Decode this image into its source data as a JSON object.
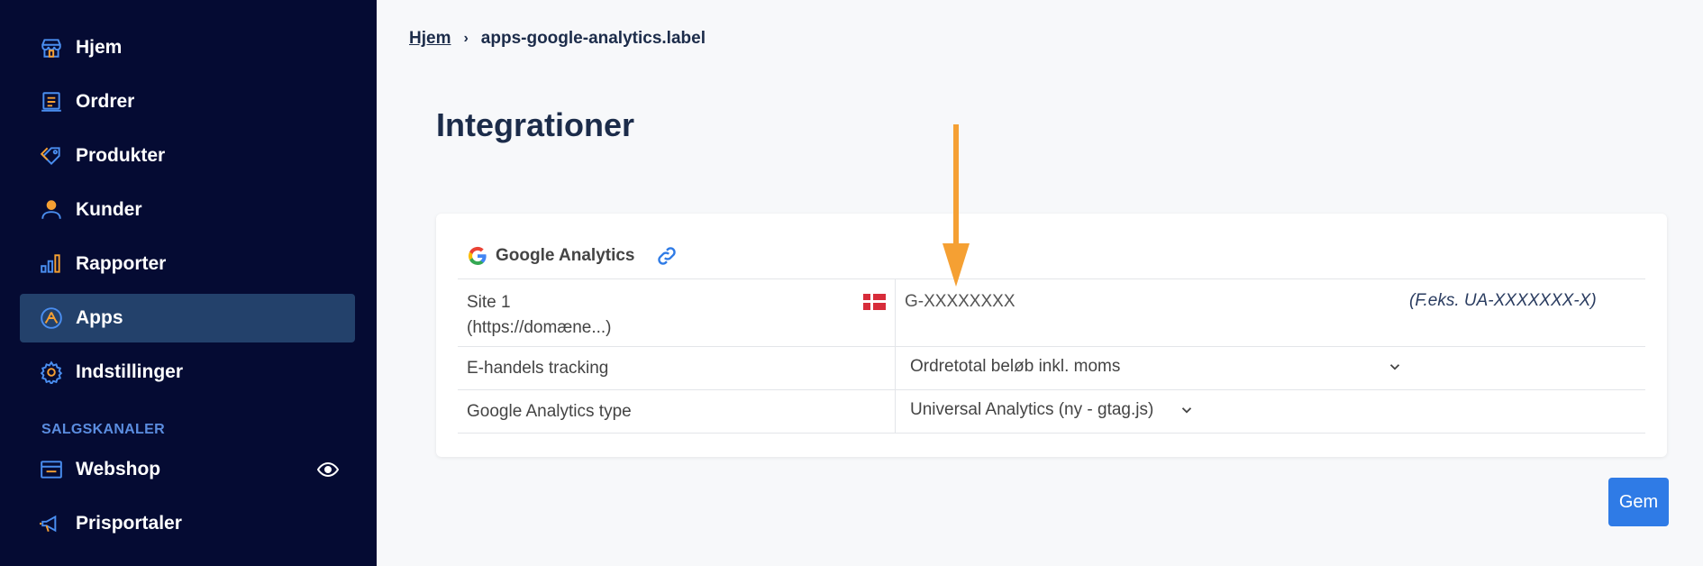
{
  "sidebar": {
    "items": [
      {
        "label": "Hjem",
        "icon": "store-icon"
      },
      {
        "label": "Ordrer",
        "icon": "list-icon"
      },
      {
        "label": "Produkter",
        "icon": "tag-icon"
      },
      {
        "label": "Kunder",
        "icon": "person-icon"
      },
      {
        "label": "Rapporter",
        "icon": "bar-chart-icon"
      },
      {
        "label": "Apps",
        "icon": "apps-icon",
        "active": true
      },
      {
        "label": "Indstillinger",
        "icon": "gear-icon"
      }
    ],
    "section_label": "SALGSKANALER",
    "channels": [
      {
        "label": "Webshop",
        "icon": "shop-window-icon",
        "extra_icon": "eye-icon"
      },
      {
        "label": "Prisportaler",
        "icon": "megaphone-icon"
      }
    ]
  },
  "breadcrumb": {
    "home": "Hjem",
    "current": "apps-google-analytics.label"
  },
  "page_title": "Integrationer",
  "card": {
    "title": "Google Analytics",
    "rows": [
      {
        "label_line1": "Site 1",
        "label_line2": "(https://domæne...)",
        "value": "G-XXXXXXXX",
        "hint": "(F.eks. UA-XXXXXXX-X)"
      },
      {
        "label": "E-handels tracking",
        "value": "Ordretotal beløb inkl. moms"
      },
      {
        "label": "Google Analytics type",
        "value": "Universal Analytics (ny - gtag.js)"
      }
    ]
  },
  "save_label": "Gem",
  "colors": {
    "sidebar_bg": "#050b33",
    "sidebar_active": "#23416b",
    "accent_orange": "#f5a033",
    "icon_blue": "#4a8ef0",
    "button_blue": "#2f7be6"
  }
}
